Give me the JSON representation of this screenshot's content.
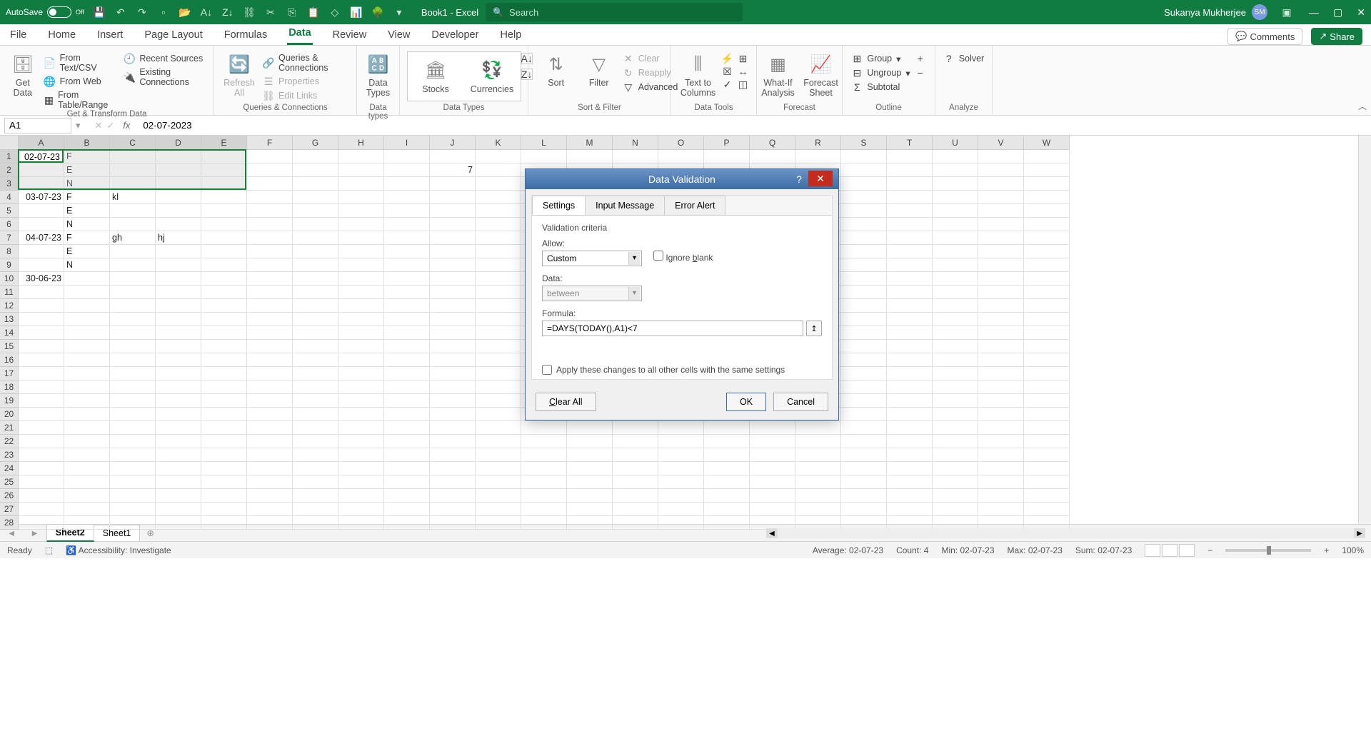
{
  "titlebar": {
    "autosave_label": "AutoSave",
    "autosave_value": "Off",
    "doc_title": "Book1 - Excel",
    "search_placeholder": "Search",
    "user_name": "Sukanya Mukherjee",
    "user_initials": "SM"
  },
  "tabs": {
    "items": [
      "File",
      "Home",
      "Insert",
      "Page Layout",
      "Formulas",
      "Data",
      "Review",
      "View",
      "Developer",
      "Help"
    ],
    "active": "Data",
    "comments": "Comments",
    "share": "Share"
  },
  "ribbon": {
    "g1": {
      "label": "Get & Transform Data",
      "get_data": "Get\nData",
      "items": [
        "From Text/CSV",
        "From Web",
        "From Table/Range",
        "Recent Sources",
        "Existing Connections"
      ]
    },
    "g2": {
      "label": "Queries & Connections",
      "refresh": "Refresh\nAll",
      "items": [
        "Queries & Connections",
        "Properties",
        "Edit Links"
      ]
    },
    "g3": {
      "label": "Data types",
      "data_types": "Data\nTypes"
    },
    "g4": {
      "label": "Data Types",
      "stocks": "Stocks",
      "currencies": "Currencies"
    },
    "g5": {
      "label": "Sort & Filter",
      "sort": "Sort",
      "filter": "Filter",
      "clear": "Clear",
      "reapply": "Reapply",
      "advanced": "Advanced"
    },
    "g6": {
      "label": "Data Tools",
      "text_to_cols": "Text to\nColumns"
    },
    "g7": {
      "label": "Forecast",
      "whatif": "What-If\nAnalysis",
      "forecast_sheet": "Forecast\nSheet"
    },
    "g8": {
      "label": "Outline",
      "group": "Group",
      "ungroup": "Ungroup",
      "subtotal": "Subtotal"
    },
    "g9": {
      "label": "Analyze",
      "solver": "Solver"
    }
  },
  "formula_bar": {
    "name_box": "A1",
    "formula": "02-07-2023"
  },
  "grid": {
    "columns": [
      "A",
      "B",
      "C",
      "D",
      "E",
      "F",
      "G",
      "H",
      "I",
      "J",
      "K",
      "L",
      "M",
      "N",
      "O",
      "P",
      "Q",
      "R",
      "S",
      "T",
      "U",
      "V",
      "W"
    ],
    "num_rows": 28,
    "selection": {
      "r1": 1,
      "c1": 1,
      "r2": 3,
      "c2": 5,
      "active": "A1"
    },
    "cells": {
      "A1": "02-07-23",
      "B1": "F",
      "B2": "E",
      "B3": "N",
      "A4": "03-07-23",
      "B4": "F",
      "C4": "kl",
      "B5": "E",
      "B6": "N",
      "A7": "04-07-23",
      "B7": "F",
      "C7": "gh",
      "D7": "hj",
      "B8": "E",
      "B9": "N",
      "A10": "30-06-23",
      "J2": "7"
    }
  },
  "sheet_tabs": {
    "sheets": [
      "Sheet2",
      "Sheet1"
    ],
    "active": "Sheet2"
  },
  "status": {
    "ready": "Ready",
    "accessibility": "Accessibility: Investigate",
    "average": "Average: 02-07-23",
    "count": "Count: 4",
    "min": "Min: 02-07-23",
    "max": "Max: 02-07-23",
    "sum": "Sum: 02-07-23",
    "zoom": "100%"
  },
  "dialog": {
    "title": "Data Validation",
    "tabs": [
      "Settings",
      "Input Message",
      "Error Alert"
    ],
    "active_tab": "Settings",
    "criteria_label": "Validation criteria",
    "allow_label": "Allow:",
    "allow_value": "Custom",
    "ignore_blank": "Ignore blank",
    "data_label": "Data:",
    "data_value": "between",
    "formula_label": "Formula:",
    "formula_value": "=DAYS(TODAY(),A1)<7",
    "apply_all": "Apply these changes to all other cells with the same settings",
    "clear_all": "Clear All",
    "ok": "OK",
    "cancel": "Cancel"
  }
}
